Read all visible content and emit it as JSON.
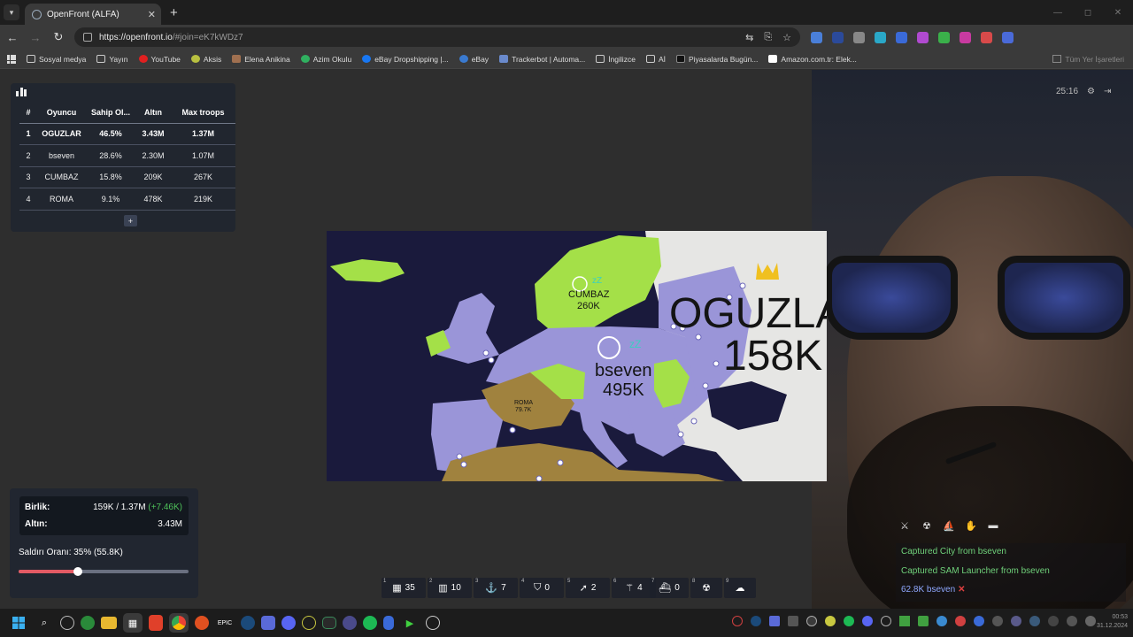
{
  "browser": {
    "tab_title": "OpenFront (ALFA)",
    "url_host": "https://openfront.io",
    "url_path": "/#join=eK7kWDz7",
    "bookmarks": [
      "Sosyal medya",
      "Yayın",
      "YouTube",
      "Aksis",
      "Elena Anikina",
      "Azim Okulu",
      "eBay Dropshipping |...",
      "eBay",
      "Trackerbot | Automa...",
      "İngilizce",
      "Aİ",
      "Piyasalarda Bugün...",
      "Amazon.com.tr: Elek..."
    ],
    "bookmarks_right": "Tüm Yer İşaretleri"
  },
  "leaderboard": {
    "headers": [
      "#",
      "Oyuncu",
      "Sahip Ol...",
      "Altın",
      "Max troops"
    ],
    "rows": [
      [
        "1",
        "OGUZLAR",
        "46.5%",
        "3.43M",
        "1.37M"
      ],
      [
        "2",
        "bseven",
        "28.6%",
        "2.30M",
        "1.07M"
      ],
      [
        "3",
        "CUMBAZ",
        "15.8%",
        "209K",
        "267K"
      ],
      [
        "4",
        "ROMA",
        "9.1%",
        "478K",
        "219K"
      ]
    ],
    "expand_label": "+"
  },
  "map": {
    "labels": {
      "cumbaz_name": "CUMBAZ",
      "cumbaz_troops": "260K",
      "bseven_name": "bseven",
      "bseven_troops": "495K",
      "oguzlar_name": "OGUZLAR",
      "oguzlar_troops": "158K",
      "roma_name": "ROMA",
      "roma_troops": "79.7K",
      "zz1": "zZ",
      "zz2": "zZ"
    }
  },
  "stats": {
    "troops_label": "Birlik:",
    "troops_value": "159K / 1.37M",
    "troops_delta": "(+7.46K)",
    "gold_label": "Altın:",
    "gold_value": "3.43M",
    "attack_label": "Saldırı Oranı: 35% (55.8K)",
    "attack_ratio": 0.35
  },
  "build_bar": [
    {
      "key": "1",
      "icon": "city-icon",
      "glyph": "▦",
      "count": "35"
    },
    {
      "key": "2",
      "icon": "factory-icon",
      "glyph": "▥",
      "count": "10"
    },
    {
      "key": "3",
      "icon": "port-icon",
      "glyph": "⚓",
      "count": "7"
    },
    {
      "key": "4",
      "icon": "defense-post-icon",
      "glyph": "⛉",
      "count": "0"
    },
    {
      "key": "5",
      "icon": "missile-silo-icon",
      "glyph": "➚",
      "count": "2"
    },
    {
      "key": "6",
      "icon": "sam-launcher-icon",
      "glyph": "⚚",
      "count": "4"
    },
    {
      "key": "7",
      "icon": "warship-icon",
      "glyph": "⛴",
      "count": "0"
    },
    {
      "key": "8",
      "icon": "atom-bomb-icon",
      "glyph": "☢",
      "count": ""
    },
    {
      "key": "9",
      "icon": "hydrogen-bomb-icon",
      "glyph": "☁",
      "count": ""
    }
  ],
  "events": [
    {
      "text": "Captured City from bseven"
    },
    {
      "text": "Captured SAM Launcher from bseven"
    },
    {
      "text": "62.8K bseven"
    }
  ],
  "timer": "25:16",
  "clock": {
    "time": "00:53",
    "date": "31.12.2024"
  },
  "colors": {
    "oguzlar": "#9a95d8",
    "bseven": "#9a95d8",
    "cumbaz": "#a4e048",
    "roma": "#a0823e",
    "ocean": "#1a1a3c",
    "neutral": "#e8e8e6"
  }
}
